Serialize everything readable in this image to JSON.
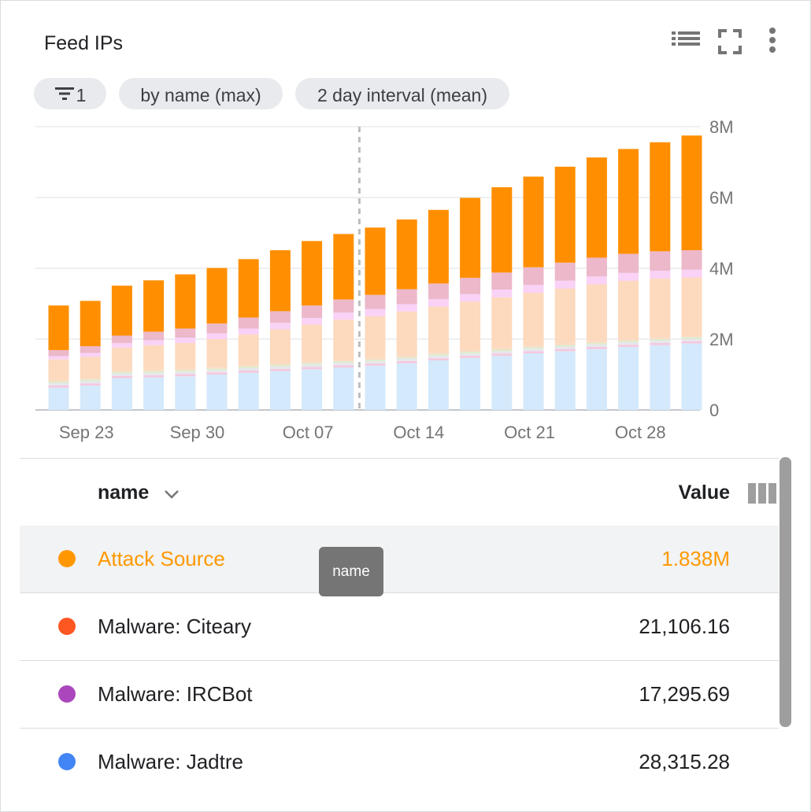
{
  "widget": {
    "title": "Feed IPs"
  },
  "chips": [
    {
      "icon": "filter-icon",
      "label": "1"
    },
    {
      "label": "by name (max)"
    },
    {
      "label": "2 day interval (mean)"
    }
  ],
  "chart_data": {
    "type": "bar",
    "stacked": true,
    "y_ticks": [
      "8M",
      "6M",
      "4M",
      "2M",
      "0"
    ],
    "x_ticks": [
      "Sep 23",
      "Sep 30",
      "Oct 07",
      "Oct 14",
      "Oct 21",
      "Oct 28"
    ],
    "ylim": [
      0,
      8000000
    ],
    "grid": true,
    "cursor_between_bar": 10,
    "bar_count": 21,
    "series": [
      {
        "color": "#d4e9fb",
        "values": [
          0.63,
          0.69,
          0.9,
          0.92,
          0.95,
          1.0,
          1.05,
          1.1,
          1.15,
          1.2,
          1.25,
          1.32,
          1.4,
          1.47,
          1.53,
          1.6,
          1.66,
          1.72,
          1.78,
          1.83,
          1.88
        ]
      },
      {
        "color": "#f6c7dc",
        "values": [
          0.06,
          0.06,
          0.06,
          0.06,
          0.06,
          0.06,
          0.06,
          0.06,
          0.06,
          0.06,
          0.06,
          0.06,
          0.06,
          0.06,
          0.06,
          0.06,
          0.06,
          0.06,
          0.06,
          0.06,
          0.06
        ]
      },
      {
        "color": "#e6e6ee",
        "values": [
          0.07,
          0.07,
          0.07,
          0.07,
          0.07,
          0.07,
          0.07,
          0.07,
          0.07,
          0.07,
          0.07,
          0.07,
          0.07,
          0.07,
          0.07,
          0.07,
          0.07,
          0.07,
          0.07,
          0.07,
          0.07
        ]
      },
      {
        "color": "#dcedc8",
        "values": [
          0.04,
          0.04,
          0.04,
          0.04,
          0.04,
          0.04,
          0.04,
          0.04,
          0.04,
          0.04,
          0.04,
          0.04,
          0.04,
          0.04,
          0.04,
          0.04,
          0.04,
          0.04,
          0.04,
          0.04,
          0.04
        ]
      },
      {
        "color": "#f8dcc6",
        "values": [
          0.05,
          0.05,
          0.05,
          0.05,
          0.05,
          0.05,
          0.05,
          0.05,
          0.05,
          0.05,
          0.05,
          0.05,
          0.05,
          0.05,
          0.05,
          0.05,
          0.05,
          0.05,
          0.05,
          0.05,
          0.05
        ]
      },
      {
        "color": "#fdd9bd",
        "values": [
          0.58,
          0.59,
          0.64,
          0.69,
          0.72,
          0.78,
          0.86,
          0.96,
          1.04,
          1.13,
          1.18,
          1.24,
          1.3,
          1.37,
          1.43,
          1.49,
          1.55,
          1.61,
          1.65,
          1.66,
          1.64
        ]
      },
      {
        "color": "#f9d2f6",
        "values": [
          0.09,
          0.11,
          0.13,
          0.14,
          0.15,
          0.16,
          0.17,
          0.18,
          0.19,
          0.2,
          0.2,
          0.21,
          0.21,
          0.21,
          0.22,
          0.22,
          0.22,
          0.22,
          0.22,
          0.22,
          0.22
        ]
      },
      {
        "color": "#ecb8ca",
        "values": [
          0.17,
          0.19,
          0.21,
          0.24,
          0.26,
          0.28,
          0.31,
          0.33,
          0.35,
          0.37,
          0.4,
          0.42,
          0.44,
          0.46,
          0.48,
          0.5,
          0.51,
          0.53,
          0.54,
          0.55,
          0.55
        ]
      },
      {
        "color": "#ff8f00",
        "values": [
          1.26,
          1.28,
          1.41,
          1.45,
          1.53,
          1.57,
          1.65,
          1.72,
          1.82,
          1.85,
          1.9,
          1.97,
          2.08,
          2.26,
          2.41,
          2.56,
          2.71,
          2.83,
          2.96,
          3.08,
          3.24
        ]
      }
    ]
  },
  "table": {
    "col_name": "name",
    "col_value": "Value",
    "rows": [
      {
        "color": "#ff9800",
        "name": "Attack Source",
        "value": "1.838M",
        "highlighted": true
      },
      {
        "color": "#ff5722",
        "name": "Malware: Citeary",
        "value": "21,106.16"
      },
      {
        "color": "#ab47bc",
        "name": "Malware: IRCBot",
        "value": "17,295.69"
      },
      {
        "color": "#4285f4",
        "name": "Malware: Jadtre",
        "value": "28,315.28"
      }
    ]
  },
  "tooltip": {
    "text": "name"
  }
}
